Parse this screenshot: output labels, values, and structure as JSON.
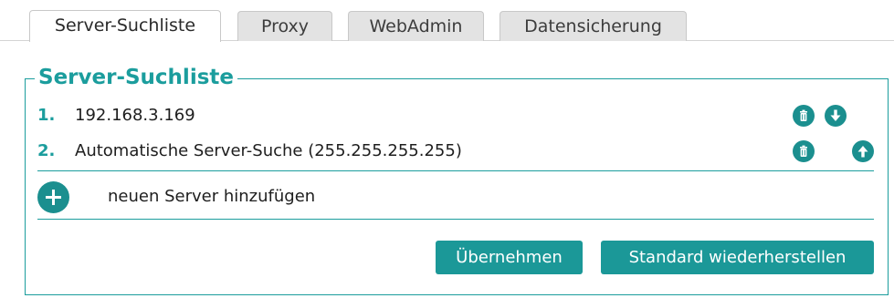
{
  "tabs": [
    {
      "label": "Server-Suchliste",
      "active": true
    },
    {
      "label": "Proxy",
      "active": false
    },
    {
      "label": "WebAdmin",
      "active": false
    },
    {
      "label": "Datensicherung",
      "active": false
    }
  ],
  "group": {
    "legend": "Server-Suchliste",
    "servers": [
      {
        "index": "1.",
        "address": "192.168.3.169",
        "actions": [
          "trash-icon",
          "arrow-down-icon"
        ]
      },
      {
        "index": "2.",
        "address": "Automatische Server-Suche (255.255.255.255)",
        "actions": [
          "trash-icon",
          "arrow-up-icon"
        ]
      }
    ],
    "add_label": "neuen Server hinzufügen"
  },
  "buttons": {
    "apply": "Übernehmen",
    "reset": "Standard wiederherstellen"
  },
  "colors": {
    "accent": "#1b9d9d",
    "icon": "#1b8f8f",
    "tab_inactive": "#e3e3e3"
  }
}
